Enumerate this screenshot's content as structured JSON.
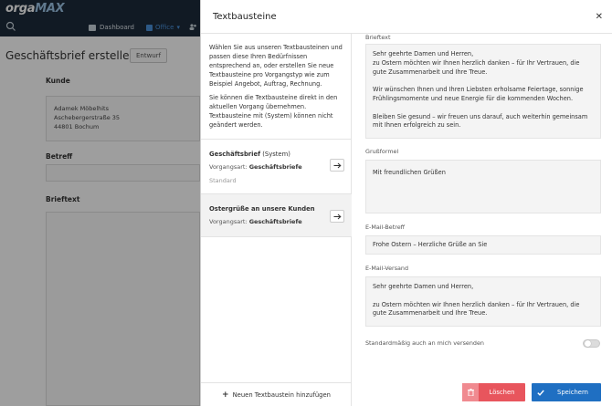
{
  "app": {
    "logo_main": "orga",
    "logo_accent": "MAX",
    "nav_dashboard": "Dashboard",
    "nav_office": "Office",
    "page_title": "Geschäftsbrief erstellen",
    "draft_badge": "Entwurf",
    "customer_label": "Kunde",
    "customer_address": [
      "Adamek Möbelhits",
      "Aschebergerstraße 35",
      "44801 Bochum"
    ],
    "subject_label": "Betreff",
    "letter_label": "Brieftext"
  },
  "dialog": {
    "title": "Textbausteine",
    "close_glyph": "✕",
    "intro_p1": "Wählen Sie aus unseren Textbausteinen und passen diese Ihren Bedürfnissen entsprechend an, oder erstellen Sie neue Textbausteine pro Vorgangstyp wie zum Beispiel Angebot, Auftrag, Rechnung.",
    "intro_p2": "Sie können die Textbausteine direkt in den aktuellen Vorgang übernehmen. Textbausteine mit (System) können nicht geändert werden.",
    "templates": [
      {
        "name": "Geschäftsbrief",
        "suffix": " (System)",
        "type_label": "Vorgangsart: ",
        "type_value": "Geschäftsbriefe",
        "default_label": "Standard"
      },
      {
        "name": "Ostergrüße an unsere Kunden",
        "suffix": "",
        "type_label": "Vorgangsart: ",
        "type_value": "Geschäftsbriefe",
        "default_label": ""
      }
    ],
    "add_label": "Neuen Textbaustein hinzufügen",
    "fields": {
      "letter_label": "Brieftext",
      "letter_text": "Sehr geehrte Damen und Herren,\nzu Ostern möchten wir Ihnen herzlich danken – für Ihr Vertrauen, die gute Zusammenarbeit und Ihre Treue.\n\nWir wünschen Ihnen und Ihren Liebsten erholsame Feiertage, sonnige Frühlingsmomente und neue Energie für die kommenden Wochen.\n\nBleiben Sie gesund – wir freuen uns darauf, auch weiterhin gemeinsam mit Ihnen erfolgreich zu sein.",
      "closing_label": "Grußformel",
      "closing_text": "Mit freundlichen Grüßen",
      "email_subject_label": "E-Mail-Betreff",
      "email_subject_text": "Frohe Ostern – Herzliche Grüße an Sie",
      "email_send_label": "E-Mail-Versand",
      "email_send_text": "Sehr geehrte Damen und Herren,\n\nzu Ostern möchten wir Ihnen herzlich danken – für Ihr Vertrauen, die gute Zusammenarbeit und Ihre Treue.",
      "cc_me_label": "Standardmäßig auch an mich versenden",
      "cc_me_enabled": false
    },
    "delete_label": "Löschen",
    "save_label": "Speichern"
  },
  "colors": {
    "topbar": "#1c2b3a",
    "delete": "#e8555d",
    "save": "#1f6fc2",
    "office_nav": "#4a90d9"
  }
}
